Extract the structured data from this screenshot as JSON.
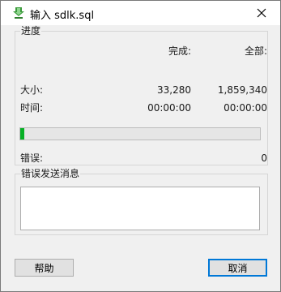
{
  "window": {
    "title": "输入 sdlk.sql",
    "icon": "import-sql-icon",
    "close_icon": "close-icon"
  },
  "progress_group": {
    "label": "进度",
    "col_done": "完成:",
    "col_total": "全部:",
    "size_label": "大小:",
    "size_done": "33,280",
    "size_total": "1,859,340",
    "time_label": "时间:",
    "time_done": "00:00:00",
    "time_total": "00:00:00",
    "progress_fraction": 0.018,
    "progress_color": "#06b025",
    "errors_label": "错误:",
    "errors_value": "0"
  },
  "error_group": {
    "label": "错误发送消息",
    "message": ""
  },
  "buttons": {
    "help": "帮助",
    "cancel": "取消"
  }
}
